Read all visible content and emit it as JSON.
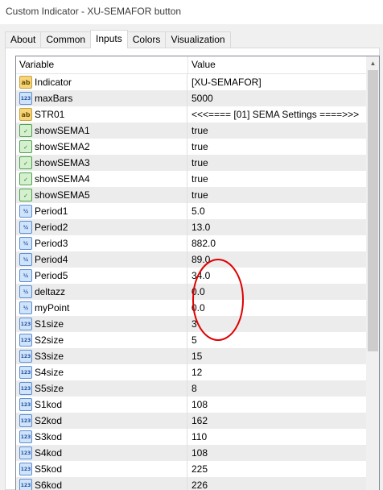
{
  "window": {
    "title": "Custom Indicator - XU-SEMAFOR button"
  },
  "tabs": [
    {
      "label": "About",
      "active": false
    },
    {
      "label": "Common",
      "active": false
    },
    {
      "label": "Inputs",
      "active": true
    },
    {
      "label": "Colors",
      "active": false
    },
    {
      "label": "Visualization",
      "active": false
    }
  ],
  "grid": {
    "columns": {
      "variable": "Variable",
      "value": "Value"
    },
    "rows": [
      {
        "type": "str",
        "icon": "string-type-icon",
        "name": "Indicator",
        "value": "[XU-SEMAFOR]"
      },
      {
        "type": "int",
        "icon": "integer-type-icon",
        "name": "maxBars",
        "value": "5000"
      },
      {
        "type": "str",
        "icon": "string-type-icon",
        "name": "STR01",
        "value": "<<<==== [01] SEMA Settings ====>>>"
      },
      {
        "type": "bool",
        "icon": "boolean-type-icon",
        "name": "showSEMA1",
        "value": "true"
      },
      {
        "type": "bool",
        "icon": "boolean-type-icon",
        "name": "showSEMA2",
        "value": "true"
      },
      {
        "type": "bool",
        "icon": "boolean-type-icon",
        "name": "showSEMA3",
        "value": "true"
      },
      {
        "type": "bool",
        "icon": "boolean-type-icon",
        "name": "showSEMA4",
        "value": "true"
      },
      {
        "type": "bool",
        "icon": "boolean-type-icon",
        "name": "showSEMA5",
        "value": "true"
      },
      {
        "type": "dbl",
        "icon": "double-type-icon",
        "name": "Period1",
        "value": "5.0"
      },
      {
        "type": "dbl",
        "icon": "double-type-icon",
        "name": "Period2",
        "value": "13.0"
      },
      {
        "type": "dbl",
        "icon": "double-type-icon",
        "name": "Period3",
        "value": "882.0"
      },
      {
        "type": "dbl",
        "icon": "double-type-icon",
        "name": "Period4",
        "value": "89.0"
      },
      {
        "type": "dbl",
        "icon": "double-type-icon",
        "name": "Period5",
        "value": "34.0"
      },
      {
        "type": "dbl",
        "icon": "double-type-icon",
        "name": "deltazz",
        "value": "0.0"
      },
      {
        "type": "dbl",
        "icon": "double-type-icon",
        "name": "myPoint",
        "value": "0.0"
      },
      {
        "type": "int",
        "icon": "integer-type-icon",
        "name": "S1size",
        "value": "3"
      },
      {
        "type": "int",
        "icon": "integer-type-icon",
        "name": "S2size",
        "value": "5"
      },
      {
        "type": "int",
        "icon": "integer-type-icon",
        "name": "S3size",
        "value": "15"
      },
      {
        "type": "int",
        "icon": "integer-type-icon",
        "name": "S4size",
        "value": "12"
      },
      {
        "type": "int",
        "icon": "integer-type-icon",
        "name": "S5size",
        "value": "8"
      },
      {
        "type": "int",
        "icon": "integer-type-icon",
        "name": "S1kod",
        "value": "108"
      },
      {
        "type": "int",
        "icon": "integer-type-icon",
        "name": "S2kod",
        "value": "162"
      },
      {
        "type": "int",
        "icon": "integer-type-icon",
        "name": "S3kod",
        "value": "110"
      },
      {
        "type": "int",
        "icon": "integer-type-icon",
        "name": "S4kod",
        "value": "108"
      },
      {
        "type": "int",
        "icon": "integer-type-icon",
        "name": "S5kod",
        "value": "225"
      },
      {
        "type": "int",
        "icon": "integer-type-icon",
        "name": "S6kod",
        "value": "226"
      }
    ]
  },
  "icon_glyphs": {
    "str": "ab",
    "int": "123",
    "bool": "✓",
    "dbl": "½"
  },
  "colors": {
    "annotation_circle": "#e00000",
    "row_alt": "#ececec",
    "scroll_thumb": "#cdcdcd"
  }
}
